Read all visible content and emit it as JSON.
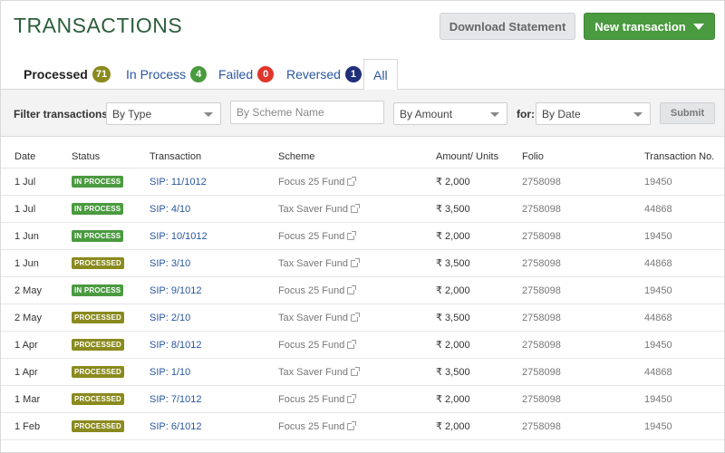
{
  "header": {
    "title": "TRANSACTIONS",
    "download_label": "Download Statement",
    "new_label": "New transaction"
  },
  "tabs": [
    {
      "label": "Processed",
      "count": "71",
      "color": "#8a8a1e"
    },
    {
      "label": "In Process",
      "count": "4",
      "color": "#4a9a3f"
    },
    {
      "label": "Failed",
      "count": "0",
      "color": "#e0352b"
    },
    {
      "label": "Reversed",
      "count": "1",
      "color": "#1f2f7a"
    },
    {
      "label": "All"
    }
  ],
  "filters": {
    "label": "Filter transactions:",
    "type_value": "By Type",
    "scheme_placeholder": "By Scheme Name",
    "amount_value": "By Amount",
    "for_label": "for:",
    "date_value": "By Date",
    "submit_label": "Submit"
  },
  "table": {
    "headers": [
      "Date",
      "Status",
      "Transaction",
      "Scheme",
      "Amount/ Units",
      "Folio",
      "Transaction No."
    ],
    "rows": [
      {
        "date": "1 Jul",
        "status": "IN PROCESS",
        "txn": "SIP: 11/1012",
        "scheme": "Focus 25 Fund",
        "amount": "₹ 2,000",
        "folio": "2758098",
        "txno": "19450"
      },
      {
        "date": "1 Jul",
        "status": "IN PROCESS",
        "txn": "SIP: 4/10",
        "scheme": "Tax Saver Fund",
        "amount": "₹ 3,500",
        "folio": "2758098",
        "txno": "44868"
      },
      {
        "date": "1 Jun",
        "status": "IN PROCESS",
        "txn": "SIP: 10/1012",
        "scheme": "Focus 25 Fund",
        "amount": "₹ 2,000",
        "folio": "2758098",
        "txno": "19450"
      },
      {
        "date": "1 Jun",
        "status": "PROCESSED",
        "txn": "SIP: 3/10",
        "scheme": "Tax Saver Fund",
        "amount": "₹ 3,500",
        "folio": "2758098",
        "txno": "44868"
      },
      {
        "date": "2 May",
        "status": "IN PROCESS",
        "txn": "SIP: 9/1012",
        "scheme": "Focus 25 Fund",
        "amount": "₹ 2,000",
        "folio": "2758098",
        "txno": "19450"
      },
      {
        "date": "2 May",
        "status": "PROCESSED",
        "txn": "SIP: 2/10",
        "scheme": "Tax Saver Fund",
        "amount": "₹ 3,500",
        "folio": "2758098",
        "txno": "44868"
      },
      {
        "date": "1 Apr",
        "status": "PROCESSED",
        "txn": "SIP: 8/1012",
        "scheme": "Focus 25 Fund",
        "amount": "₹ 2,000",
        "folio": "2758098",
        "txno": "19450"
      },
      {
        "date": "1 Apr",
        "status": "PROCESSED",
        "txn": "SIP: 1/10",
        "scheme": "Tax Saver Fund",
        "amount": "₹ 3,500",
        "folio": "2758098",
        "txno": "44868"
      },
      {
        "date": "1 Mar",
        "status": "PROCESSED",
        "txn": "SIP: 7/1012",
        "scheme": "Focus 25 Fund",
        "amount": "₹ 2,000",
        "folio": "2758098",
        "txno": "19450"
      },
      {
        "date": "1 Feb",
        "status": "PROCESSED",
        "txn": "SIP: 6/1012",
        "scheme": "Focus 25 Fund",
        "amount": "₹ 2,000",
        "folio": "2758098",
        "txno": "19450"
      }
    ]
  },
  "status_colors": {
    "IN PROCESS": "#4a9a3f",
    "PROCESSED": "#8a8a1e"
  }
}
